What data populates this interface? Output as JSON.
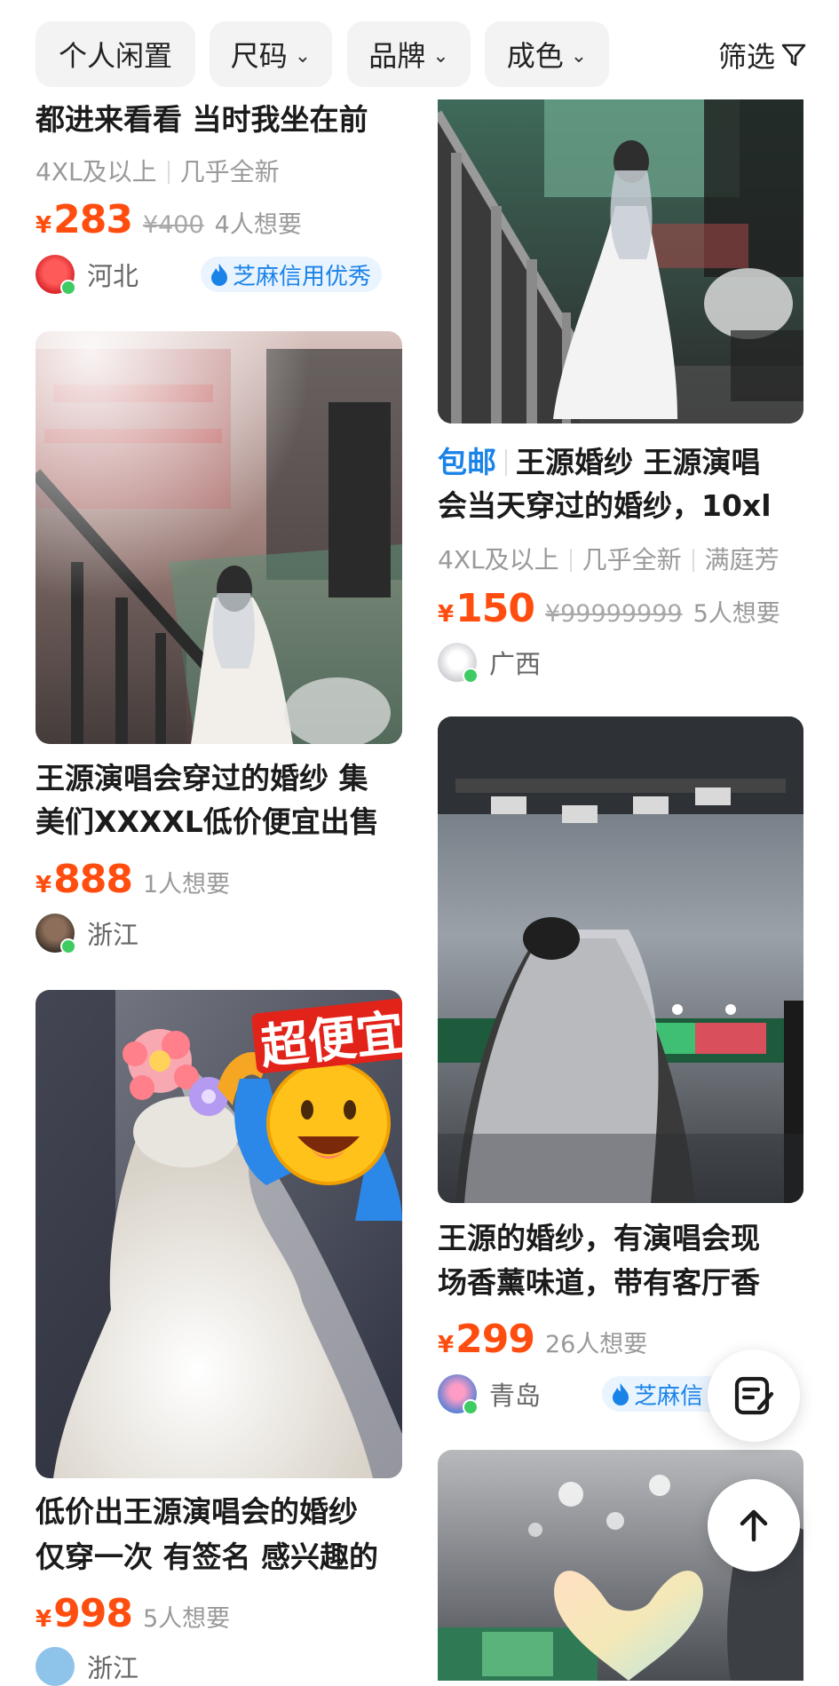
{
  "filters": {
    "chip1": "个人闲置",
    "chip2": "尺码",
    "chip3": "品牌",
    "chip4": "成色",
    "filter": "筛选",
    "chevron_icon": "chevron-down-icon",
    "filter_icon": "funnel-icon"
  },
  "left": {
    "item0": {
      "title": "都进来看看 当时我坐在前",
      "size": "4XL及以上",
      "condition": "几乎全新",
      "price_symbol": "¥",
      "price": "283",
      "orig_price": "¥400",
      "want": "4人想要",
      "region": "河北",
      "credit": "芝麻信用优秀"
    },
    "item1": {
      "title1": "王源演唱会穿过的婚纱 集",
      "title2": "美们XXXXL低价便宜出售",
      "price_symbol": "¥",
      "price": "888",
      "want": "1人想要",
      "region": "浙江"
    },
    "item2": {
      "sticker": "超便宜",
      "title1": "低价出王源演唱会的婚纱",
      "title2": "仅穿一次 有签名 感兴趣的",
      "price_symbol": "¥",
      "price": "998",
      "want": "5人想要",
      "region": "浙江"
    }
  },
  "right": {
    "item0": {
      "tag": "包邮",
      "title1": "王源婚纱 王源演唱",
      "title2": "会当天穿过的婚纱，10xl",
      "size": "4XL及以上",
      "condition": "几乎全新",
      "brand": "满庭芳",
      "price_symbol": "¥",
      "price": "150",
      "orig_price": "¥99999999",
      "want": "5人想要",
      "region": "广西"
    },
    "item1": {
      "title1": "王源的婚纱，有演唱会现",
      "title2": "场香薰味道，带有客厅香",
      "price_symbol": "¥",
      "price": "299",
      "want": "26人想要",
      "region": "青岛",
      "credit": "芝麻信"
    }
  },
  "colors": {
    "price": "#ff4d0f",
    "link_blue": "#1a83e8",
    "online_dot": "#3ecb62"
  },
  "floating": {
    "edit_icon": "note-edit-icon",
    "top_icon": "arrow-up-icon"
  }
}
